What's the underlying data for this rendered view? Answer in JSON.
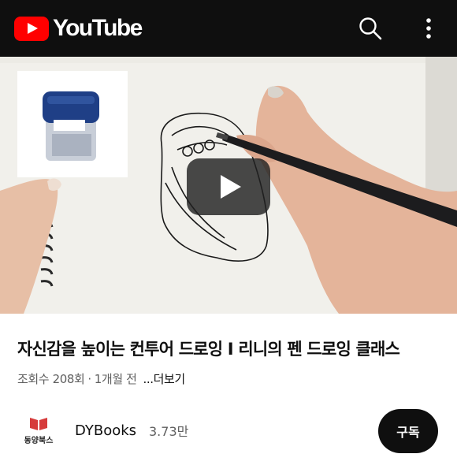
{
  "header": {
    "logo_text": "YouTube",
    "icons": [
      "youtube-logo-icon",
      "search-icon",
      "more-vertical-icon"
    ],
    "brand_color": "#ff0000",
    "background": "#0f0f0f"
  },
  "video": {
    "icons": [
      "play-icon"
    ]
  },
  "info": {
    "title": "자신감을 높이는 컨투어 드로잉 I 리니의 펜 드로잉 클래스",
    "views": "조회수 208회",
    "separator": "·",
    "age": "1개월 전",
    "more": "...더보기"
  },
  "channel": {
    "name": "DYBooks",
    "subscribers": "3.73만",
    "logo_text": "동양북스",
    "subscribe_label": "구독"
  }
}
